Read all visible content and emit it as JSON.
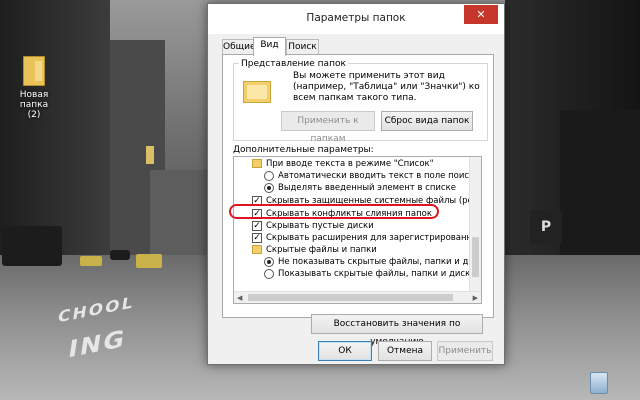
{
  "desktop": {
    "folder_icon": {
      "label": "Новая папка",
      "sublabel": "(2)"
    },
    "recycle_bin_icon": "recycle-bin-icon"
  },
  "wallpaper": {
    "road_texts": [
      "CHOOL",
      "ING"
    ],
    "parking_sign": "P"
  },
  "dialog": {
    "title": "Параметры папок",
    "close_glyph": "✕",
    "tabs": [
      {
        "label": "Общие",
        "active": false
      },
      {
        "label": "Вид",
        "active": true
      },
      {
        "label": "Поиск",
        "active": false
      }
    ],
    "view_group": {
      "legend": "Представление папок",
      "description": "Вы можете применить этот вид (например, \"Таблица\" или \"Значки\") ко всем папкам такого типа.",
      "apply_button": "Применить к папкам",
      "reset_button": "Сброс вида папок"
    },
    "advanced_label": "Дополнительные параметры:",
    "tree_items": [
      {
        "type": "folder",
        "label": "При вводе текста в режиме \"Список\""
      },
      {
        "type": "radio",
        "checked": false,
        "label": "Автоматически вводить текст в поле поиска"
      },
      {
        "type": "radio",
        "checked": true,
        "label": "Выделять введенный элемент в списке"
      },
      {
        "type": "checkbox",
        "checked": true,
        "label": "Скрывать защищенные системные файлы (рекомен"
      },
      {
        "type": "checkbox",
        "checked": true,
        "label": "Скрывать конфликты слияния папок"
      },
      {
        "type": "checkbox",
        "checked": true,
        "label": "Скрывать пустые диски"
      },
      {
        "type": "checkbox",
        "checked": true,
        "label": "Скрывать расширения для зарегистрированных типо"
      },
      {
        "type": "folder",
        "label": "Скрытые файлы и папки"
      },
      {
        "type": "radio",
        "checked": true,
        "label": "Не показывать скрытые файлы, папки и диски"
      },
      {
        "type": "radio",
        "checked": false,
        "label": "Показывать скрытые файлы, папки и диски"
      }
    ],
    "restore_defaults_button": "Восстановить значения по умолчанию",
    "ok_button": "ОК",
    "cancel_button": "Отмена",
    "apply_button": "Применить",
    "apply_enabled": false
  },
  "colors": {
    "annotation_outline": "#e0141e",
    "close_button": "#c7362b"
  }
}
